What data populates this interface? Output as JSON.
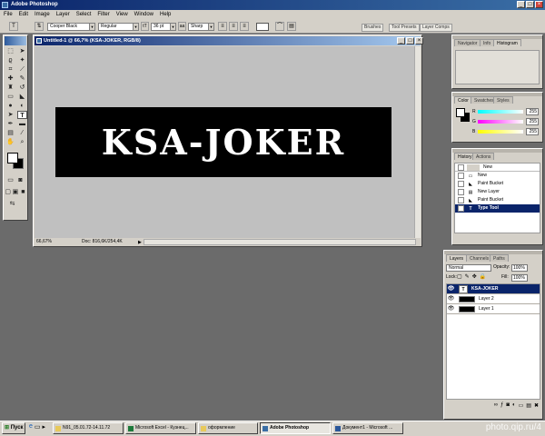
{
  "app": {
    "title": "Adobe Photoshop"
  },
  "menu": [
    "File",
    "Edit",
    "Image",
    "Layer",
    "Select",
    "Filter",
    "View",
    "Window",
    "Help"
  ],
  "options": {
    "font_family": "Cooper Black",
    "font_style": "Regular",
    "font_size": "36 pt",
    "antialias": "Sharp",
    "palette_tabs": [
      "Brushes",
      "Tool Presets",
      "Layer Comps"
    ]
  },
  "document": {
    "title": "Untitled-1 @ 66,7% (KSA-JOKER, RGB/8)",
    "text": "KSA-JOKER",
    "zoom": "66,67%",
    "doc_info": "Doc: 816,6K/254,4K"
  },
  "navigator": {
    "tabs": [
      "Navigator",
      "Info",
      "Histogram"
    ]
  },
  "color": {
    "tabs": [
      "Color",
      "Swatches",
      "Styles"
    ],
    "channels": [
      {
        "label": "R",
        "value": "255"
      },
      {
        "label": "G",
        "value": "255"
      },
      {
        "label": "B",
        "value": "255"
      }
    ]
  },
  "history": {
    "tabs": [
      "History",
      "Actions"
    ],
    "snapshot": "New",
    "items": [
      "New",
      "Paint Bucket",
      "New Layer",
      "Paint Bucket",
      "Type Tool"
    ]
  },
  "layers": {
    "tabs": [
      "Layers",
      "Channels",
      "Paths"
    ],
    "blend_mode": "Normal",
    "opacity_label": "Opacity:",
    "opacity": "100%",
    "lock_label": "Lock:",
    "fill_label": "Fill:",
    "fill": "100%",
    "items": [
      {
        "name": "KSA-JOKER",
        "type_icon": "T"
      },
      {
        "name": "Layer 2"
      },
      {
        "name": "Layer 1"
      }
    ]
  },
  "taskbar": {
    "start": "Пуск",
    "items": [
      {
        "label": "N91_05.01.72-14.11.72"
      },
      {
        "label": "Microsoft Excel - Кузнец..."
      },
      {
        "label": "оформление"
      },
      {
        "label": "Adobe Photoshop"
      },
      {
        "label": "Документ1 - Microsoft ..."
      }
    ],
    "watermark": "photo.qip.ru/4"
  },
  "colors": {
    "title_bar": "#0a246a",
    "selection": "#0a246a",
    "canvas": "#c0c0c0",
    "workspace": "#6b6b6b"
  }
}
